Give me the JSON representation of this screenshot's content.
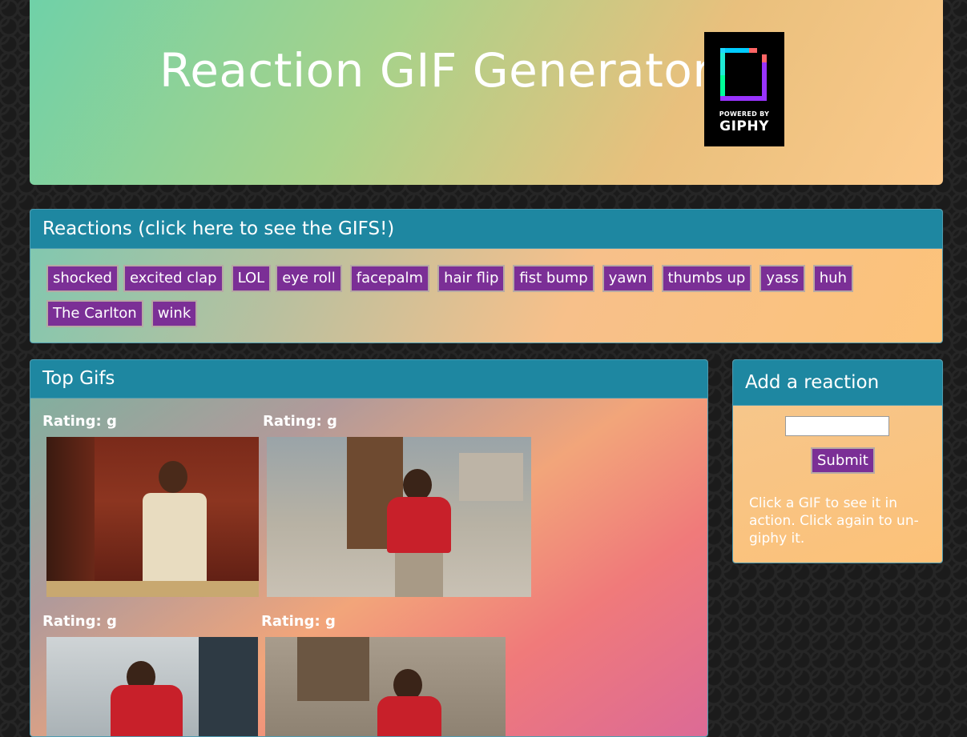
{
  "header": {
    "title": "Reaction GIF Generator",
    "logo": {
      "powered_by": "POWERED BY",
      "brand": "GIPHY",
      "icon": "giphy-logo-icon"
    }
  },
  "reactions_panel": {
    "title": "Reactions (click here to see the GIFS!)",
    "buttons": [
      "shocked",
      "excited clap",
      "LOL",
      "eye roll",
      "facepalm",
      "hair flip",
      "fist bump",
      "yawn",
      "thumbs up",
      "yass",
      "huh",
      "The Carlton",
      "wink"
    ]
  },
  "top_gifs_panel": {
    "title": "Top Gifs",
    "gifs": [
      {
        "rating": "Rating: g"
      },
      {
        "rating": "Rating: g"
      },
      {
        "rating": "Rating: g"
      },
      {
        "rating": "Rating: g"
      }
    ]
  },
  "add_reaction_panel": {
    "title": "Add a reaction",
    "input_value": "",
    "submit_label": "Submit",
    "hint": "Click a GIF to see it in action. Click again to un-giphy it."
  },
  "colors": {
    "accent_purple": "#7b2f96",
    "panel_heading": "#1e87a1",
    "background": "#1b1b1b"
  }
}
